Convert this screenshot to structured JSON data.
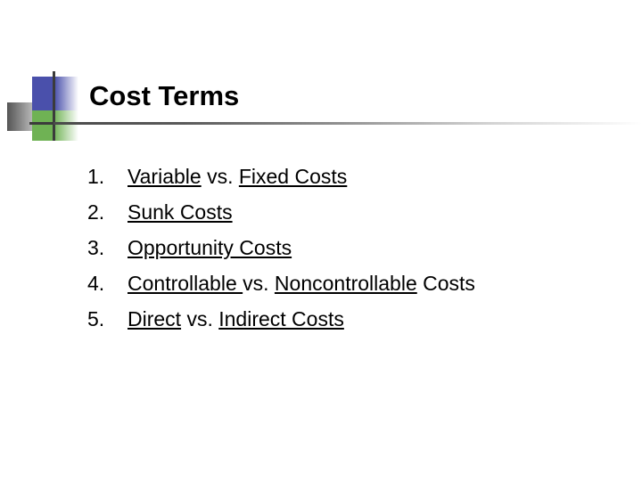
{
  "slide": {
    "title": "Cost Terms",
    "background_color": "#ffffff",
    "text_color": "#000000"
  },
  "decoration": {
    "blue_square_color": "#4a50ab",
    "green_square_color": "#6fb254",
    "gray_square_color": "#555555",
    "cross_line_color": "#3b3b3b",
    "rule_color": "#4a4a4a"
  },
  "list": {
    "items": [
      {
        "number": "1.",
        "segments": [
          {
            "text": "Variable",
            "underline": true
          },
          {
            "text": " vs. ",
            "underline": false
          },
          {
            "text": "Fixed Costs",
            "underline": true
          }
        ]
      },
      {
        "number": "2.",
        "segments": [
          {
            "text": "Sunk Costs",
            "underline": true
          }
        ]
      },
      {
        "number": "3.",
        "segments": [
          {
            "text": "Opportunity Costs",
            "underline": true
          }
        ]
      },
      {
        "number": "4.",
        "segments": [
          {
            "text": "Controllable ",
            "underline": true
          },
          {
            "text": "vs. ",
            "underline": false
          },
          {
            "text": "Noncontrollable",
            "underline": true
          },
          {
            "text": " Costs",
            "underline": false
          }
        ]
      },
      {
        "number": "5.",
        "segments": [
          {
            "text": "Direct",
            "underline": true
          },
          {
            "text": " vs. ",
            "underline": false
          },
          {
            "text": "Indirect Costs",
            "underline": true
          }
        ]
      }
    ]
  }
}
